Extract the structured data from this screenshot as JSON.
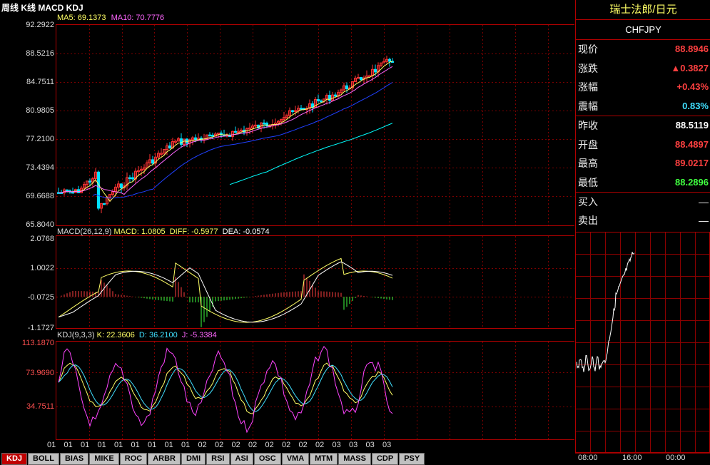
{
  "app_title": "周线 K线 MACD KDJ",
  "kline": {
    "legend": {
      "ma5": "MA5: 69.1373",
      "ma10": "MA10: 70.7776"
    },
    "y_ticks": [
      "92.2922",
      "88.5216",
      "84.7511",
      "80.9805",
      "77.2100",
      "73.4394",
      "69.6688",
      "65.8040"
    ]
  },
  "macd": {
    "legend": {
      "params": "MACD(26,12,9)",
      "macd": "MACD: 1.0805",
      "diff": "DIFF: -0.5977",
      "dea": "DEA: -0.0574"
    },
    "y_ticks": [
      "2.0768",
      "1.0022",
      "-0.0725",
      "-1.1727"
    ]
  },
  "kdj": {
    "legend": {
      "params": "KDJ(9,3,3)",
      "k": "K: 22.3606",
      "d": "D: 36.2100",
      "j": "J: -5.3384"
    },
    "y_ticks": [
      "113.1870",
      "73.9690",
      "34.7511"
    ]
  },
  "x_axis_labels": [
    "01",
    "01",
    "01",
    "01",
    "01",
    "01",
    "01",
    "01",
    "01",
    "02",
    "02",
    "02",
    "02",
    "02",
    "02",
    "02",
    "02",
    "03",
    "03",
    "03",
    "03"
  ],
  "tabs": [
    "KDJ",
    "BOLL",
    "BIAS",
    "MIKE",
    "ROC",
    "ARBR",
    "DMI",
    "RSI",
    "ASI",
    "OSC",
    "VMA",
    "MTM",
    "MASS",
    "CDP",
    "PSY"
  ],
  "active_tab": "KDJ",
  "quote": {
    "name": "瑞士法郎/日元",
    "code": "CHFJPY",
    "rows": [
      {
        "label": "现价",
        "value": "88.8946",
        "color": "#ff4040"
      },
      {
        "label": "涨跌",
        "value": "▲0.3827",
        "color": "#ff4040"
      },
      {
        "label": "涨幅",
        "value": "+0.43%",
        "color": "#ff4040"
      },
      {
        "label": "震幅",
        "value": "0.83%",
        "color": "#40e0ff"
      },
      {
        "label": "昨收",
        "value": "88.5119",
        "color": "#ffffff"
      },
      {
        "label": "开盘",
        "value": "88.4897",
        "color": "#ff4040"
      },
      {
        "label": "最高",
        "value": "89.0217",
        "color": "#ff4040"
      },
      {
        "label": "最低",
        "value": "88.2896",
        "color": "#40ff40"
      }
    ],
    "bid_ask": [
      {
        "label": "买入",
        "value": "—"
      },
      {
        "label": "卖出",
        "value": "—"
      }
    ]
  },
  "intraday": {
    "time_labels": [
      "08:00",
      "16:00",
      "00:00"
    ]
  },
  "colors": {
    "up": "#ff3333",
    "down": "#00e0ff",
    "grid": "#8b0000",
    "ma5": "#ffff66",
    "ma10": "#ff66ff",
    "ma20": "#2040ff",
    "ma60": "#00ffff"
  }
}
